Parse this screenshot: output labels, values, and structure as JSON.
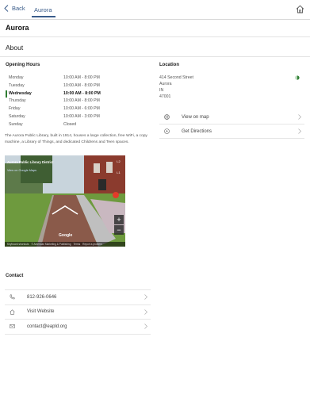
{
  "nav": {
    "back_label": "Back",
    "breadcrumb": "Aurora"
  },
  "page": {
    "title": "Aurora",
    "section": "About"
  },
  "hours": {
    "heading": "Opening Hours",
    "rows": [
      {
        "day": "Monday",
        "time": "10:00 AM - 8:00 PM"
      },
      {
        "day": "Tuesday",
        "time": "10:00 AM - 8:00 PM"
      },
      {
        "day": "Wednesday",
        "time": "10:00 AM - 8:00 PM",
        "today": true
      },
      {
        "day": "Thursday",
        "time": "10:00 AM - 8:00 PM"
      },
      {
        "day": "Friday",
        "time": "10:00 AM - 6:00 PM"
      },
      {
        "day": "Saturday",
        "time": "10:00 AM - 3:00 PM"
      },
      {
        "day": "Sunday",
        "time": "Closed"
      }
    ],
    "description": "The Aurora Public Library, built in 1914, houses a large collection, free WiFi, a copy machine, a Library of Things, and dedicated Childrens and Teen spaces."
  },
  "streetview": {
    "title": "Aurora Public Library District",
    "link": "View on Google Maps",
    "levels": [
      "L2",
      "L1"
    ],
    "zoom_in": "+",
    "zoom_out": "−",
    "brand": "Google",
    "footer": [
      "Keyboard shortcuts",
      "© American Marketing & Publishing",
      "Terms",
      "Report a problem"
    ]
  },
  "location": {
    "heading": "Location",
    "street": "414 Second Street",
    "city": "Aurora",
    "state": "IN",
    "zip": "47001",
    "status_color": "#2e7d32",
    "actions": [
      {
        "label": "View on map",
        "icon": "globe-icon"
      },
      {
        "label": "Get Directions",
        "icon": "directions-icon"
      }
    ]
  },
  "contact": {
    "heading": "Contact",
    "items": [
      {
        "label": "812-926-0646",
        "icon": "phone-icon"
      },
      {
        "label": "Visit Website",
        "icon": "home-icon"
      },
      {
        "label": "contact@eapld.org",
        "icon": "mail-icon"
      }
    ]
  },
  "colors": {
    "accent": "#3a5c8a",
    "today_marker": "#2e7d32"
  }
}
